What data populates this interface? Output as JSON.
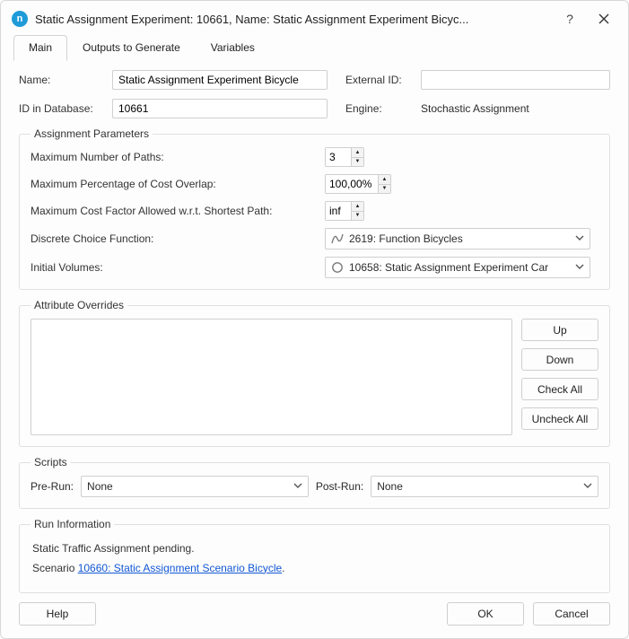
{
  "title": "Static Assignment Experiment: 10661, Name: Static Assignment Experiment Bicyc...",
  "help_glyph": "?",
  "tabs": [
    "Main",
    "Outputs to Generate",
    "Variables"
  ],
  "active_tab": 0,
  "fields": {
    "name_label": "Name:",
    "name_value": "Static Assignment Experiment Bicycle",
    "ext_id_label": "External ID:",
    "ext_id_value": "",
    "db_id_label": "ID in Database:",
    "db_id_value": "10661",
    "engine_label": "Engine:",
    "engine_value": "Stochastic Assignment"
  },
  "params": {
    "legend": "Assignment Parameters",
    "max_paths_label": "Maximum Number of Paths:",
    "max_paths_value": "3",
    "max_overlap_label": "Maximum Percentage of Cost Overlap:",
    "max_overlap_value": "100,00%",
    "max_cost_label": "Maximum Cost Factor Allowed w.r.t. Shortest Path:",
    "max_cost_value": "inf",
    "dcf_label": "Discrete Choice Function:",
    "dcf_value": "2619: Function Bicycles",
    "init_vol_label": "Initial Volumes:",
    "init_vol_value": "10658: Static Assignment Experiment Car"
  },
  "attr": {
    "legend": "Attribute Overrides",
    "up": "Up",
    "down": "Down",
    "check_all": "Check All",
    "uncheck_all": "Uncheck All"
  },
  "scripts": {
    "legend": "Scripts",
    "pre_label": "Pre-Run:",
    "pre_value": "None",
    "post_label": "Post-Run:",
    "post_value": "None"
  },
  "runinfo": {
    "legend": "Run Information",
    "line1": "Static Traffic Assignment pending.",
    "line2_prefix": "Scenario ",
    "line2_link": "10660: Static Assignment Scenario Bicycle",
    "line2_suffix": "."
  },
  "footer": {
    "help": "Help",
    "ok": "OK",
    "cancel": "Cancel"
  }
}
